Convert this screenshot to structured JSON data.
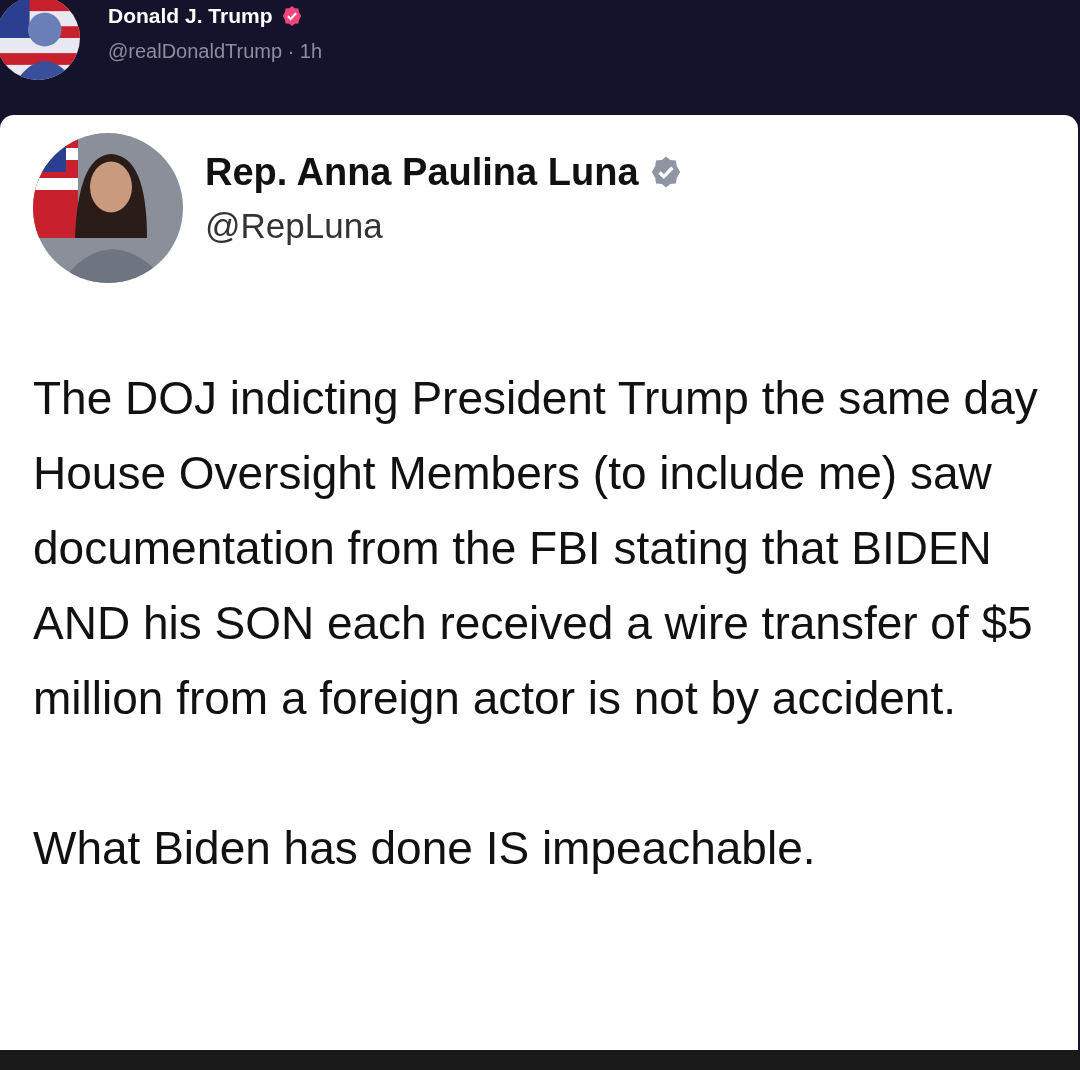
{
  "post": {
    "author": {
      "name": "Donald J. Trump",
      "verified": true,
      "handle": "@realDonaldTrump · 1h"
    },
    "quoted": {
      "name": "Rep. Anna Paulina Luna",
      "verified": true,
      "handle": "@RepLuna",
      "paragraphs": [
        "The DOJ indicting President Trump the same day House Oversight Members (to include me) saw documentation from the FBI stating that BIDEN AND his SON each received a wire transfer of $5 million from a foreign actor is not by accident.",
        "What Biden has done IS impeachable."
      ]
    }
  }
}
